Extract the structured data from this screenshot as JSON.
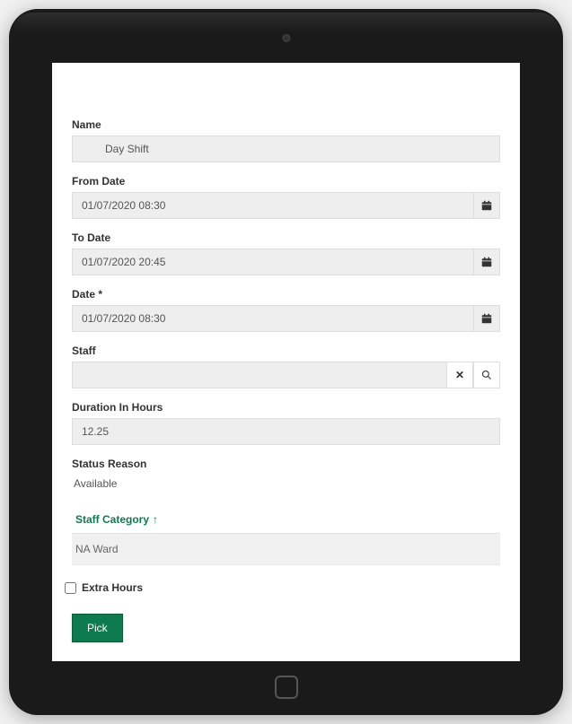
{
  "fields": {
    "name_label": "Name",
    "name_value": "Day Shift",
    "from_date_label": "From Date",
    "from_date_value": "01/07/2020 08:30",
    "to_date_label": "To Date",
    "to_date_value": "01/07/2020 20:45",
    "date_label": "Date *",
    "date_value": "01/07/2020 08:30",
    "staff_label": "Staff",
    "staff_value": "",
    "duration_label": "Duration In Hours",
    "duration_value": "12.25",
    "status_reason_label": "Status Reason",
    "status_reason_value": "Available"
  },
  "table": {
    "column_header": "Staff Category",
    "row_value": "NA Ward"
  },
  "checkbox": {
    "label": "Extra Hours"
  },
  "actions": {
    "pick_label": "Pick"
  }
}
